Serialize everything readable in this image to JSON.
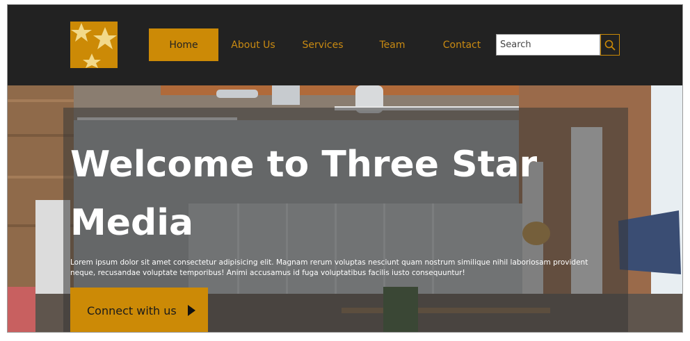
{
  "header": {
    "logo_icon": "three-stars-logo",
    "nav": [
      {
        "label": "Home",
        "active": true
      },
      {
        "label": "About Us",
        "active": false
      },
      {
        "label": "Services",
        "active": false
      },
      {
        "label": "Team",
        "active": false
      },
      {
        "label": "Contact",
        "active": false
      }
    ],
    "search": {
      "placeholder": "Search",
      "value": "",
      "icon": "search-icon"
    }
  },
  "hero": {
    "title": "Welcome to Three Star Media",
    "text": "Lorem ipsum dolor sit amet consectetur adipisicing elit. Magnam rerum voluptas nesciunt quam nostrum similique nihil laboriosam provident neque, recusandae voluptate temporibus! Animi accusamus id fuga voluptatibus facilis iusto consequuntur!",
    "cta_label": "Connect with us",
    "cta_icon": "play-arrow-icon",
    "background": "office-interior-photo"
  },
  "colors": {
    "accent": "#cc8a06",
    "header_bg": "#222222",
    "overlay": "rgba(55,55,55,0.55)"
  }
}
